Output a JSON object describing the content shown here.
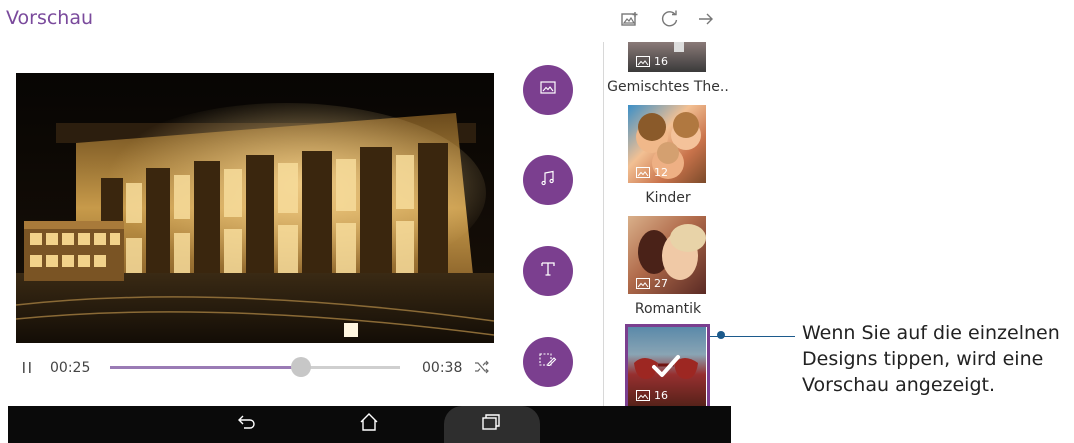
{
  "header": {
    "title": "Vorschau",
    "icons": [
      "add-photo-icon",
      "refresh-icon",
      "arrow-right-icon"
    ]
  },
  "player": {
    "elapsed": "00:25",
    "total": "00:38",
    "progress": 0.66,
    "icons": [
      "pause-icon",
      "shuffle-icon"
    ]
  },
  "fab_actions": [
    "image-icon",
    "music-note-icon",
    "text-format-icon",
    "edit-frame-icon"
  ],
  "themes": [
    {
      "label": "Gemischtes The..",
      "count": "16"
    },
    {
      "label": "Kinder",
      "count": "12"
    },
    {
      "label": "Romantik",
      "count": "27"
    },
    {
      "label": "",
      "count": "16",
      "selected": true
    }
  ],
  "callout": {
    "text": "Wenn Sie auf die einzelnen Designs tippen, wird eine Vorschau angezeigt."
  },
  "navbar": {
    "icons": [
      "back-icon",
      "home-icon",
      "recents-icon"
    ]
  },
  "colors": {
    "accent": "#7b3f8f",
    "title": "#7a4a9c",
    "callout": "#1c5a8c"
  }
}
